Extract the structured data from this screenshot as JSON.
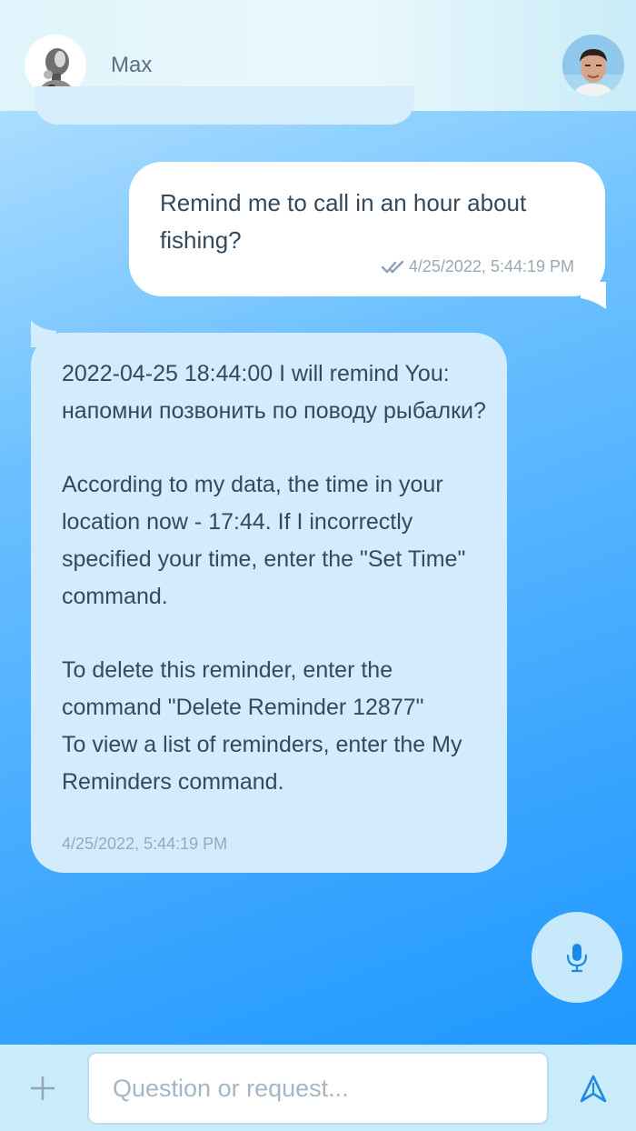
{
  "header": {
    "contact_name": "Max",
    "bot_avatar_icon": "robot-avatar",
    "user_avatar_icon": "user-photo-avatar"
  },
  "messages": [
    {
      "direction": "outgoing",
      "text": "Remind me to call in an hour about fishing?",
      "timestamp": "4/25/2022, 5:44:19 PM",
      "status_icon": "double-check-icon"
    },
    {
      "direction": "incoming",
      "text": "2022-04-25 18:44:00 I will remind You: напомни позвонить по поводу рыбалки?\n\nAccording to my data, the time in your location now - 17:44. If I incorrectly specified your time, enter the \"Set Time\" command.\n\nTo delete this reminder, enter the command \"Delete Reminder 12877\"\nTo view a list of reminders, enter the My Reminders command.",
      "timestamp": "4/25/2022, 5:44:19 PM"
    }
  ],
  "composer": {
    "placeholder": "Question or request...",
    "value": "",
    "attach_icon": "plus-icon",
    "send_icon": "send-icon",
    "mic_icon": "microphone-icon"
  },
  "colors": {
    "accent": "#1e88e5",
    "header_bg": "#e5f6fb",
    "incoming_bubble": "#d3ecfd",
    "outgoing_bubble": "#ffffff"
  }
}
